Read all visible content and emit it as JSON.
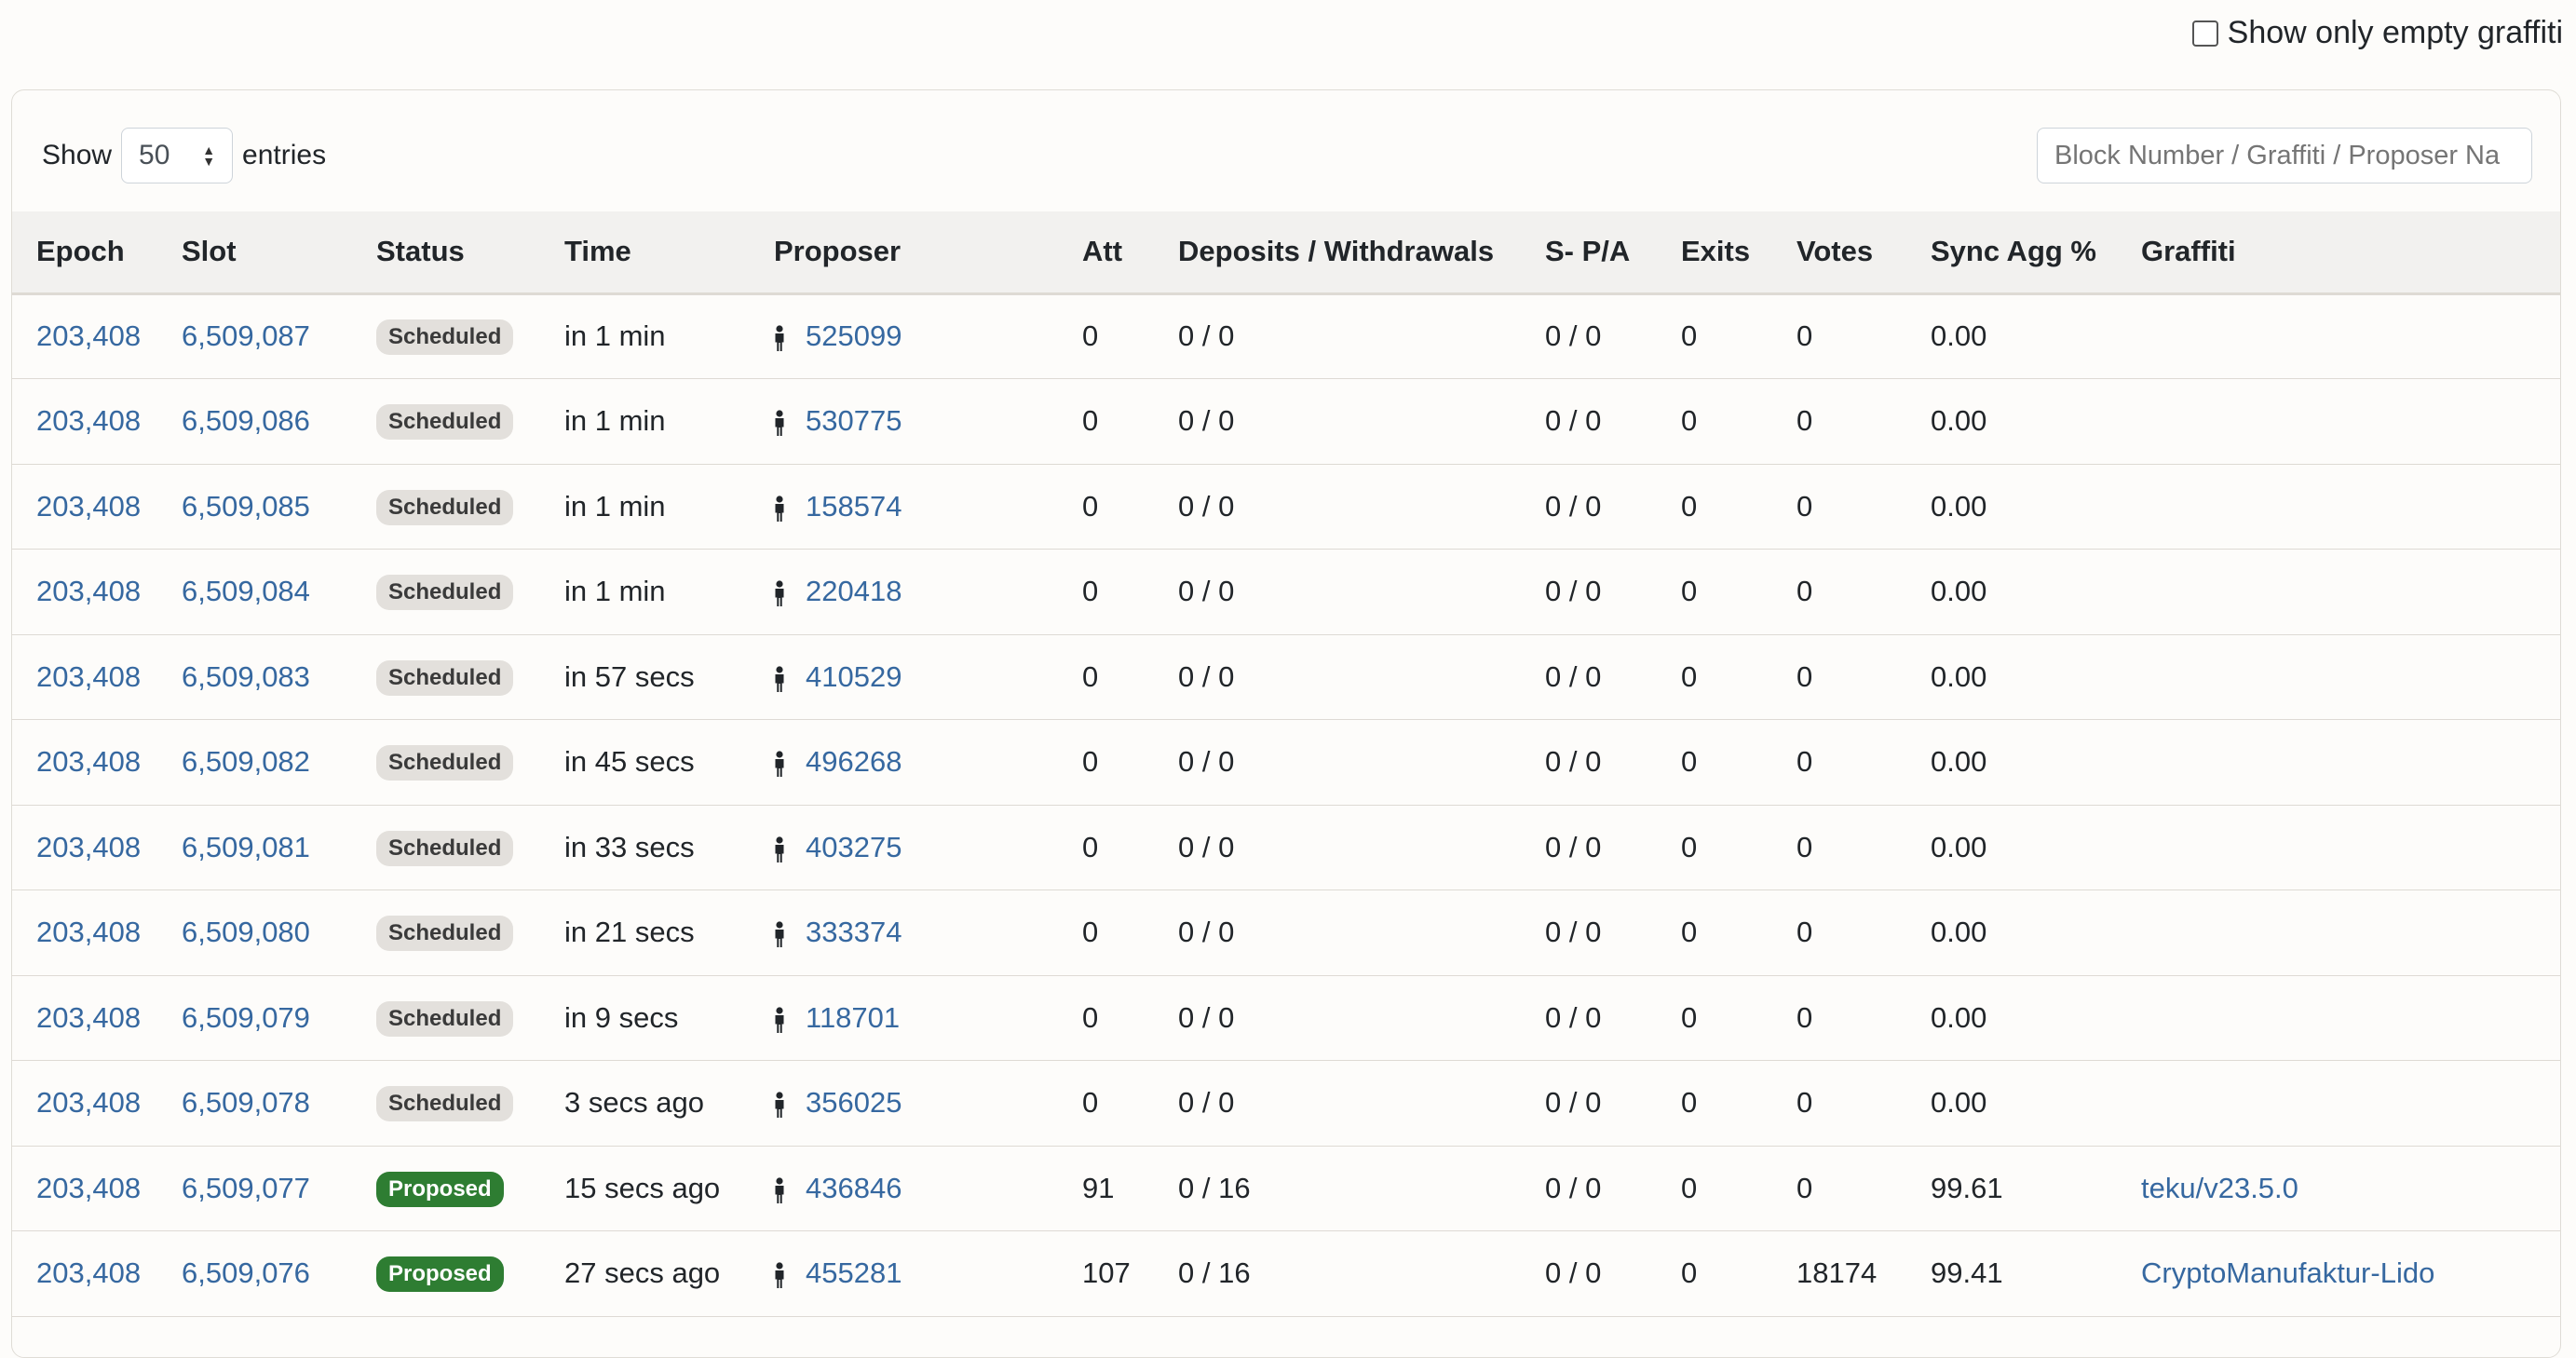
{
  "filter": {
    "empty_graffiti_label": "Show only empty graffiti"
  },
  "length_menu": {
    "show_label": "Show",
    "selected": "50",
    "entries_label": "entries"
  },
  "search": {
    "placeholder": "Block Number / Graffiti / Proposer Na"
  },
  "columns": [
    "Epoch",
    "Slot",
    "Status",
    "Time",
    "Proposer",
    "Att",
    "Deposits / Withdrawals",
    "S- P/A",
    "Exits",
    "Votes",
    "Sync Agg %",
    "Graffiti"
  ],
  "colors": {
    "link": "#3668a0",
    "scheduled_badge": "#e3e0dc",
    "proposed_badge": "#2e7d32"
  },
  "icons": {
    "proposer": "person-icon",
    "select": "sort-arrows-icon"
  },
  "rows": [
    {
      "epoch": "203,408",
      "slot": "6,509,087",
      "status": "Scheduled",
      "time": "in 1 min",
      "proposer": "525099",
      "att": "0",
      "deposits": "0 / 0",
      "spa": "0 / 0",
      "exits": "0",
      "votes": "0",
      "sync": "0.00",
      "graffiti": ""
    },
    {
      "epoch": "203,408",
      "slot": "6,509,086",
      "status": "Scheduled",
      "time": "in 1 min",
      "proposer": "530775",
      "att": "0",
      "deposits": "0 / 0",
      "spa": "0 / 0",
      "exits": "0",
      "votes": "0",
      "sync": "0.00",
      "graffiti": ""
    },
    {
      "epoch": "203,408",
      "slot": "6,509,085",
      "status": "Scheduled",
      "time": "in 1 min",
      "proposer": "158574",
      "att": "0",
      "deposits": "0 / 0",
      "spa": "0 / 0",
      "exits": "0",
      "votes": "0",
      "sync": "0.00",
      "graffiti": ""
    },
    {
      "epoch": "203,408",
      "slot": "6,509,084",
      "status": "Scheduled",
      "time": "in 1 min",
      "proposer": "220418",
      "att": "0",
      "deposits": "0 / 0",
      "spa": "0 / 0",
      "exits": "0",
      "votes": "0",
      "sync": "0.00",
      "graffiti": ""
    },
    {
      "epoch": "203,408",
      "slot": "6,509,083",
      "status": "Scheduled",
      "time": "in 57 secs",
      "proposer": "410529",
      "att": "0",
      "deposits": "0 / 0",
      "spa": "0 / 0",
      "exits": "0",
      "votes": "0",
      "sync": "0.00",
      "graffiti": ""
    },
    {
      "epoch": "203,408",
      "slot": "6,509,082",
      "status": "Scheduled",
      "time": "in 45 secs",
      "proposer": "496268",
      "att": "0",
      "deposits": "0 / 0",
      "spa": "0 / 0",
      "exits": "0",
      "votes": "0",
      "sync": "0.00",
      "graffiti": ""
    },
    {
      "epoch": "203,408",
      "slot": "6,509,081",
      "status": "Scheduled",
      "time": "in 33 secs",
      "proposer": "403275",
      "att": "0",
      "deposits": "0 / 0",
      "spa": "0 / 0",
      "exits": "0",
      "votes": "0",
      "sync": "0.00",
      "graffiti": ""
    },
    {
      "epoch": "203,408",
      "slot": "6,509,080",
      "status": "Scheduled",
      "time": "in 21 secs",
      "proposer": "333374",
      "att": "0",
      "deposits": "0 / 0",
      "spa": "0 / 0",
      "exits": "0",
      "votes": "0",
      "sync": "0.00",
      "graffiti": ""
    },
    {
      "epoch": "203,408",
      "slot": "6,509,079",
      "status": "Scheduled",
      "time": "in 9 secs",
      "proposer": "118701",
      "att": "0",
      "deposits": "0 / 0",
      "spa": "0 / 0",
      "exits": "0",
      "votes": "0",
      "sync": "0.00",
      "graffiti": ""
    },
    {
      "epoch": "203,408",
      "slot": "6,509,078",
      "status": "Scheduled",
      "time": "3 secs ago",
      "proposer": "356025",
      "att": "0",
      "deposits": "0 / 0",
      "spa": "0 / 0",
      "exits": "0",
      "votes": "0",
      "sync": "0.00",
      "graffiti": ""
    },
    {
      "epoch": "203,408",
      "slot": "6,509,077",
      "status": "Proposed",
      "time": "15 secs ago",
      "proposer": "436846",
      "att": "91",
      "deposits": "0 / 16",
      "spa": "0 / 0",
      "exits": "0",
      "votes": "0",
      "sync": "99.61",
      "graffiti": "teku/v23.5.0"
    },
    {
      "epoch": "203,408",
      "slot": "6,509,076",
      "status": "Proposed",
      "time": "27 secs ago",
      "proposer": "455281",
      "att": "107",
      "deposits": "0 / 16",
      "spa": "0 / 0",
      "exits": "0",
      "votes": "18174",
      "sync": "99.41",
      "graffiti": "CryptoManufaktur-Lido"
    }
  ]
}
